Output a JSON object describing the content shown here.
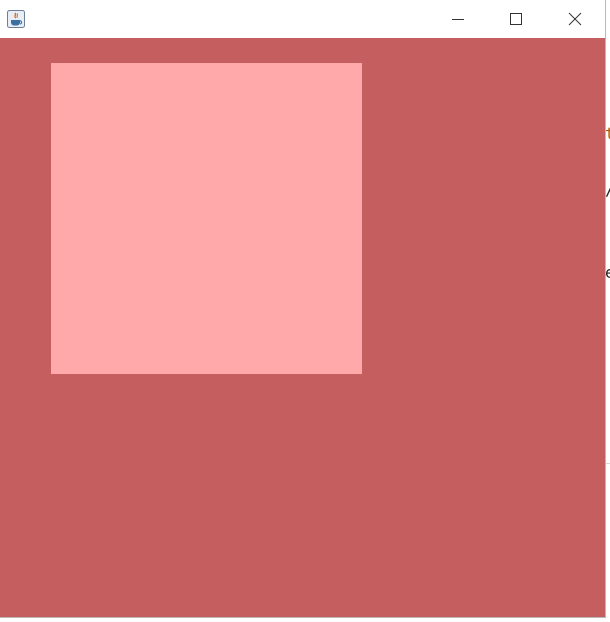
{
  "window": {
    "title": "",
    "controls": {
      "minimize_icon": "minimize-icon",
      "maximize_icon": "maximize-icon",
      "close_icon": "close-icon"
    }
  },
  "canvas": {
    "background_color": "#c45e5f",
    "square_color": "#ffa9ab"
  },
  "background_window": {
    "fragments": [
      "t",
      "/",
      "e"
    ],
    "fragment_colors": [
      "#b25a00",
      "#222222",
      "#222222"
    ]
  }
}
